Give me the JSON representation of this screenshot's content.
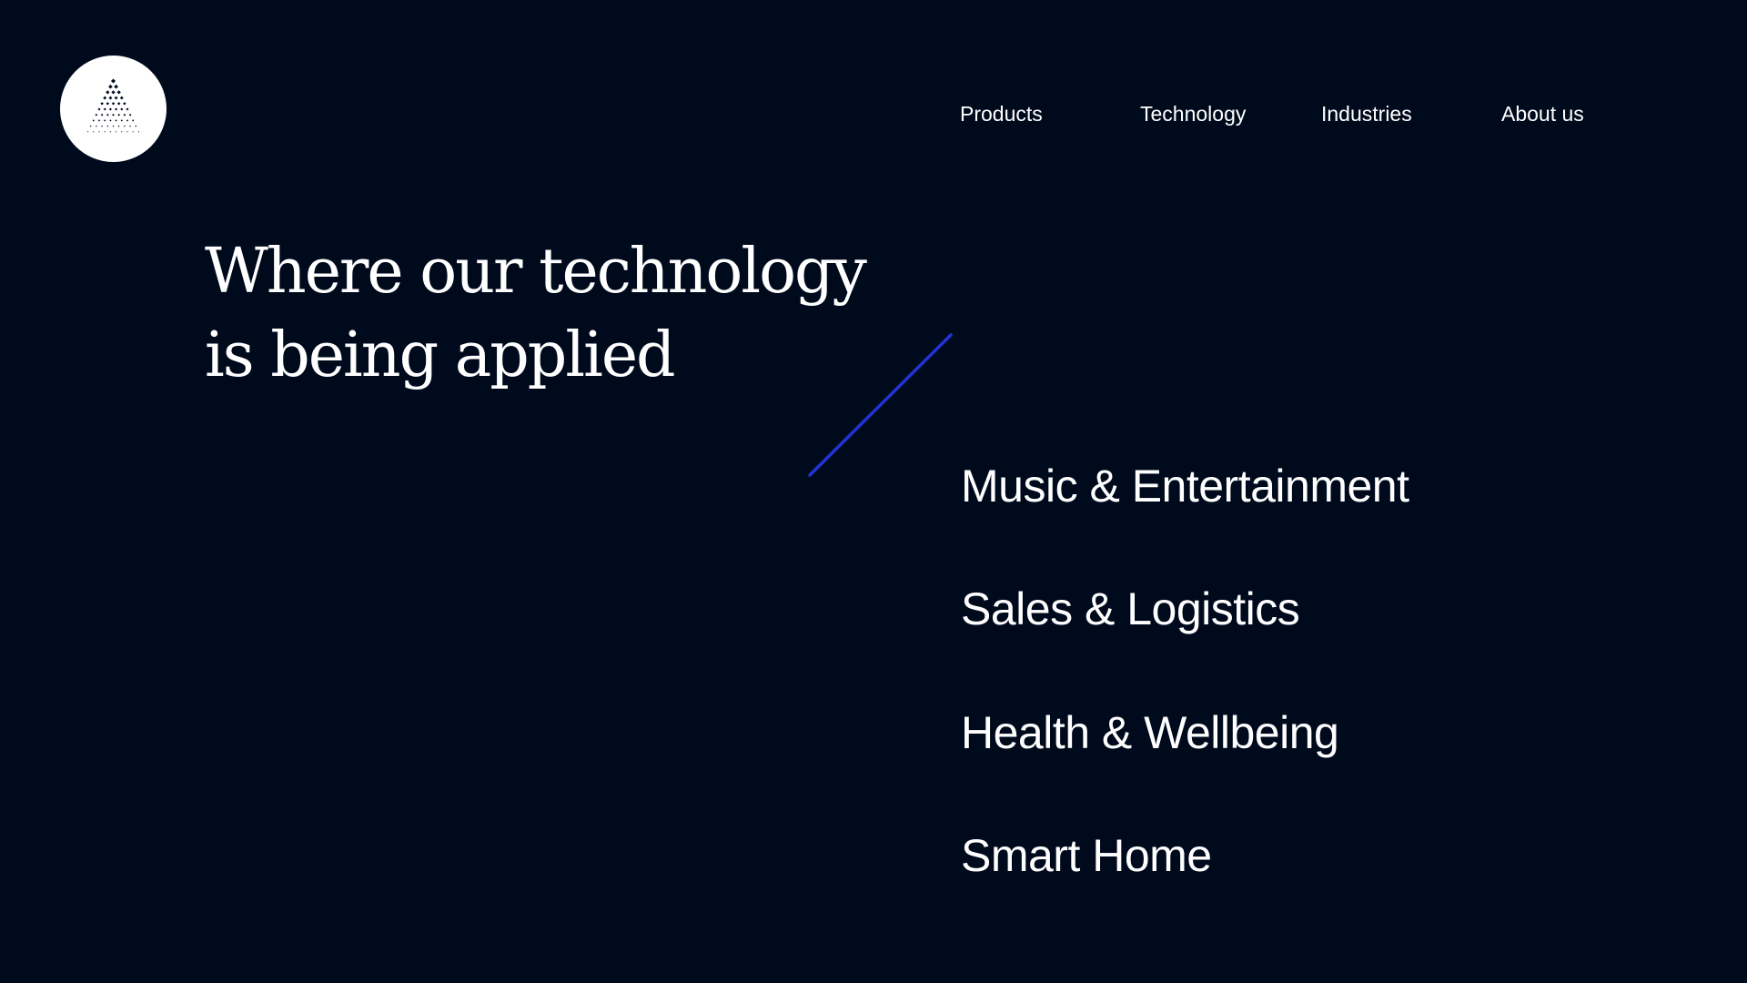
{
  "colors": {
    "background": "#000a1d",
    "text": "#ffffff",
    "accent_line": "#2233d6",
    "logo_disc": "#ffffff",
    "logo_dots": "#000a1d"
  },
  "logo": {
    "icon": "dotted-pyramid-logo"
  },
  "nav": {
    "items": [
      {
        "label": "Products"
      },
      {
        "label": "Technology"
      },
      {
        "label": "Industries"
      },
      {
        "label": "About us"
      }
    ]
  },
  "hero": {
    "title_line1": "Where our technology",
    "title_line2": "is being applied"
  },
  "industries": {
    "items": [
      {
        "label": "Music & Entertainment"
      },
      {
        "label": "Sales & Logistics"
      },
      {
        "label": "Health & Wellbeing"
      },
      {
        "label": "Smart Home"
      }
    ]
  }
}
